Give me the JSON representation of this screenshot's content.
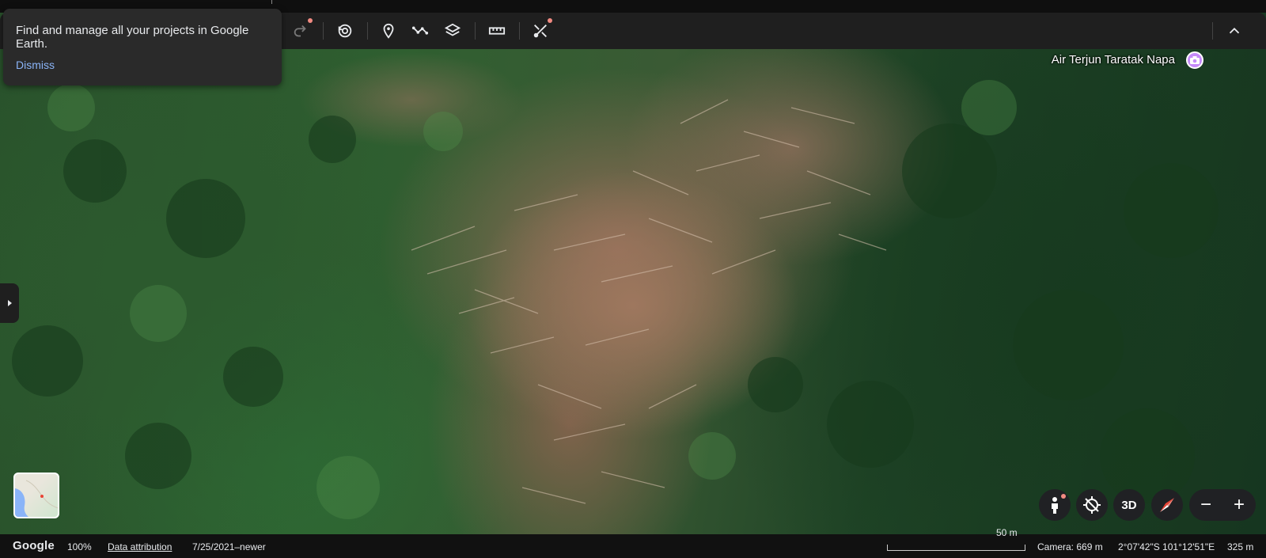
{
  "popup": {
    "message": "Find and manage all your projects in Google Earth.",
    "dismiss_label": "Dismiss"
  },
  "map": {
    "place_label": "Air Terjun Taratak Napa"
  },
  "toolbar": {
    "icons": [
      "redo-icon",
      "historical-imagery-icon",
      "add-placemark-icon",
      "add-path-icon",
      "map-style-icon",
      "measure-icon",
      "tools-icon",
      "collapse-icon"
    ]
  },
  "controls": {
    "three_d_label": "3D",
    "zoom_out_label": "−",
    "zoom_in_label": "+"
  },
  "status": {
    "logo": "Google",
    "zoom_percent": "100%",
    "data_attribution": "Data attribution",
    "imagery_date": "7/25/2021–newer",
    "scale_label": "50 m",
    "camera": "Camera: 669 m",
    "coordinates": "2°07'42\"S 101°12'51\"E",
    "elevation": "325 m"
  },
  "colors": {
    "toolbar_bg": "#1f1f1f",
    "accent_link": "#8ab4f8",
    "notification_dot": "#f28b82",
    "place_pin": "#c58af9"
  }
}
